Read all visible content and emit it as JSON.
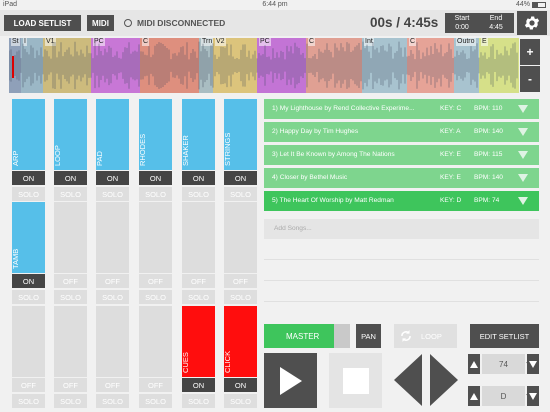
{
  "status_bar": {
    "device": "iPad",
    "time": "6:44 pm",
    "battery": "44%"
  },
  "top_bar": {
    "load_setlist": "LOAD SETLIST",
    "midi": "MIDI",
    "midi_status": "MIDI DISCONNECTED",
    "time_display": "00s / 4:45s",
    "start_label": "Start",
    "start_value": "0:00",
    "end_label": "End",
    "end_value": "4:45"
  },
  "waveform": {
    "zoom_in": "+",
    "zoom_out": "-",
    "sections": [
      {
        "label": "St",
        "color": "#8fa0b9"
      },
      {
        "label": "I",
        "color": "#9bb7c6"
      },
      {
        "label": "V1",
        "color": "#cdbb7d"
      },
      {
        "label": "PC",
        "color": "#c877d6"
      },
      {
        "label": "C",
        "color": "#de8f7e"
      },
      {
        "label": "Trn",
        "color": "#a9bdc2"
      },
      {
        "label": "V2",
        "color": "#dcc47c"
      },
      {
        "label": "PC",
        "color": "#c374d5"
      },
      {
        "label": "C",
        "color": "#e0a093"
      },
      {
        "label": "Int",
        "color": "#a8c3cf"
      },
      {
        "label": "C",
        "color": "#e6a397"
      },
      {
        "label": "Outro",
        "color": "#a8c3cf"
      },
      {
        "label": "E",
        "color": "#d6e089"
      }
    ]
  },
  "mixer": {
    "rows": [
      [
        {
          "name": "ARP",
          "color": "blue",
          "state": "ON",
          "solo": "SOLO"
        },
        {
          "name": "LOOP",
          "color": "blue",
          "state": "ON",
          "solo": "SOLO"
        },
        {
          "name": "PAD",
          "color": "blue",
          "state": "ON",
          "solo": "SOLO"
        },
        {
          "name": "RHODES",
          "color": "blue",
          "state": "ON",
          "solo": "SOLO"
        },
        {
          "name": "SHAKER",
          "color": "blue",
          "state": "ON",
          "solo": "SOLO"
        },
        {
          "name": "STRINGS",
          "color": "blue",
          "state": "ON",
          "solo": "SOLO"
        }
      ],
      [
        {
          "name": "TAMB",
          "color": "blue",
          "state": "ON",
          "solo": "SOLO"
        },
        {
          "name": "",
          "color": "gray",
          "state": "OFF",
          "solo": "SOLO"
        },
        {
          "name": "",
          "color": "gray",
          "state": "OFF",
          "solo": "SOLO"
        },
        {
          "name": "",
          "color": "gray",
          "state": "OFF",
          "solo": "SOLO"
        },
        {
          "name": "",
          "color": "gray",
          "state": "OFF",
          "solo": "SOLO"
        },
        {
          "name": "",
          "color": "gray",
          "state": "OFF",
          "solo": "SOLO"
        }
      ],
      [
        {
          "name": "",
          "color": "gray",
          "state": "OFF",
          "solo": "SOLO"
        },
        {
          "name": "",
          "color": "gray",
          "state": "OFF",
          "solo": "SOLO"
        },
        {
          "name": "",
          "color": "gray",
          "state": "OFF",
          "solo": "SOLO"
        },
        {
          "name": "",
          "color": "gray",
          "state": "OFF",
          "solo": "SOLO"
        },
        {
          "name": "CUES",
          "color": "red",
          "state": "ON",
          "solo": "SOLO"
        },
        {
          "name": "CLICK",
          "color": "red",
          "state": "ON",
          "solo": "SOLO"
        }
      ]
    ]
  },
  "setlist": {
    "songs": [
      {
        "title": "1) My Lighthouse  by Rend Collective Experime...",
        "key": "KEY: C",
        "bpm": "BPM: 110",
        "active": false
      },
      {
        "title": "2) Happy Day  by Tim Hughes",
        "key": "KEY: A",
        "bpm": "BPM: 140",
        "active": false
      },
      {
        "title": "3) Let It Be Known  by Among The Nations",
        "key": "KEY: E",
        "bpm": "BPM: 115",
        "active": false
      },
      {
        "title": "4) Closer  by Bethel Music",
        "key": "KEY: E",
        "bpm": "BPM: 140",
        "active": false
      },
      {
        "title": "5) The Heart Of Worship  by Matt Redman",
        "key": "KEY: D",
        "bpm": "BPM: 74",
        "active": true
      }
    ],
    "add_songs": "Add Songs..."
  },
  "transport": {
    "master": "MASTER",
    "pan": "PAN",
    "loop": "LOOP",
    "edit_setlist": "EDIT SETLIST",
    "bpm_value": "74",
    "key_value": "D"
  },
  "colors": {
    "blue": "#56bfe9",
    "green": "#3ec55c",
    "light_green": "#7ed58e",
    "red": "#ff0d0d",
    "dark": "#4f4f4f"
  }
}
